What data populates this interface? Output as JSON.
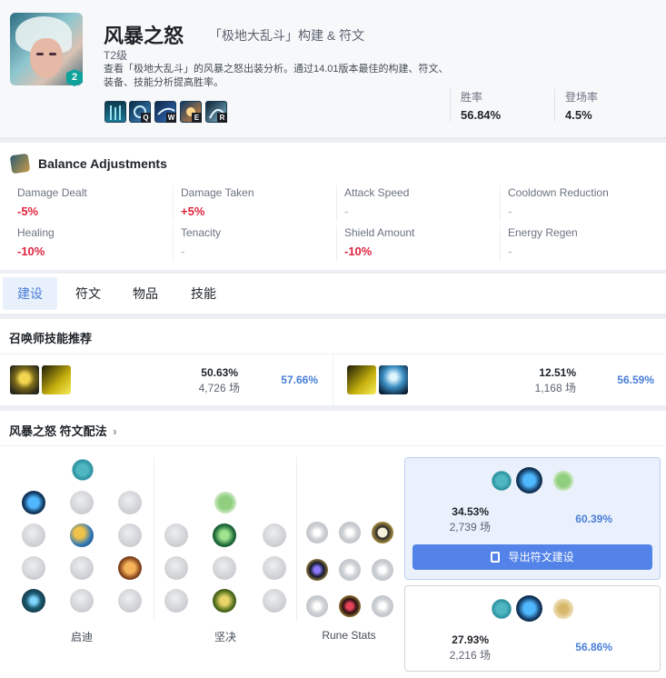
{
  "header": {
    "champion_name": "风暴之怒",
    "mode": "「极地大乱斗」构建 & 符文",
    "tier": "T2级",
    "level_badge": "2",
    "description": "查看「极地大乱斗」的风暴之怒出装分析。通过14.01版本最佳的构建、符文、装备、技能分析提高胜率。",
    "skills": [
      "passive-icon",
      "Q",
      "W",
      "E",
      "R"
    ],
    "win_rate_label": "胜率",
    "win_rate": "56.84%",
    "pick_rate_label": "登场率",
    "pick_rate": "4.5%"
  },
  "balance": {
    "title": "Balance Adjustments",
    "items": [
      {
        "label": "Damage Dealt",
        "value": "-5%"
      },
      {
        "label": "Damage Taken",
        "value": "+5%"
      },
      {
        "label": "Attack Speed",
        "value": "-"
      },
      {
        "label": "Cooldown Reduction",
        "value": "-"
      },
      {
        "label": "Healing",
        "value": "-10%"
      },
      {
        "label": "Tenacity",
        "value": "-"
      },
      {
        "label": "Shield Amount",
        "value": "-10%"
      },
      {
        "label": "Energy Regen",
        "value": "-"
      }
    ]
  },
  "tabs": [
    "建设",
    "符文",
    "物品",
    "技能"
  ],
  "summoner": {
    "title": "召唤师技能推荐",
    "sets": [
      {
        "spells": [
          "clarity-icon",
          "ghost-icon"
        ],
        "pick": "50.63%",
        "games": "4,726 场",
        "win": "57.66%"
      },
      {
        "spells": [
          "ghost-icon",
          "cleanse-icon"
        ],
        "pick": "12.51%",
        "games": "1,168 场",
        "win": "56.59%"
      }
    ]
  },
  "runes": {
    "title": "风暴之怒 符文配法",
    "title_chevron": "›",
    "col_labels": [
      "启迪",
      "坚决",
      "Rune Stats"
    ],
    "cards": [
      {
        "pick": "34.53%",
        "games": "2,739 场",
        "win": "60.39%",
        "export_label": "导出符文建设"
      },
      {
        "pick": "27.93%",
        "games": "2,216 场",
        "win": "56.86%"
      }
    ]
  },
  "colors": {
    "accent": "#5383e8",
    "negative": "#e0243f",
    "badge": "#0fa39b"
  }
}
